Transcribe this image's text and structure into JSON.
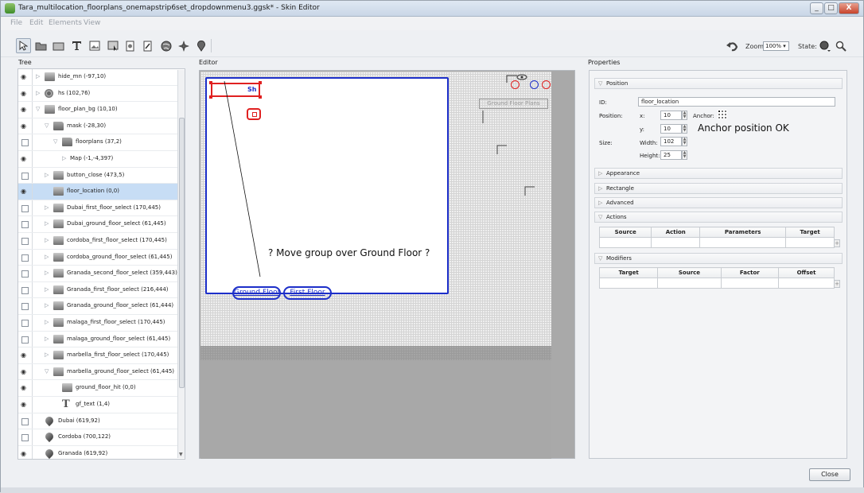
{
  "window": {
    "title": "Tara_multilocation_floorplans_onemapstrip6set_dropdownmenu3.ggsk* - Skin Editor",
    "minimize": "_",
    "maximize": "□",
    "close": "X"
  },
  "menu": [
    "File",
    "Edit",
    "Elements",
    "View"
  ],
  "toolbar": {
    "tools": [
      "select-tool",
      "folder-tool",
      "rectangle-tool",
      "text-tool",
      "image-tool",
      "button-tool",
      "hotspot-tool",
      "code-tool",
      "globe-tool",
      "compass-tool",
      "marker-tool"
    ],
    "zoom_label": "Zoom:",
    "zoom_value": "100%",
    "state_label": "State:"
  },
  "panels": {
    "tree": "Tree",
    "editor": "Editor",
    "properties": "Properties"
  },
  "tree": {
    "items": [
      {
        "label": "hide_mn (-97,10)",
        "visible": true,
        "expander": "closed",
        "icon": "rect",
        "indent": 0
      },
      {
        "label": "hs (102,76)",
        "visible": true,
        "expander": "closed",
        "icon": "hs",
        "indent": 0
      },
      {
        "label": "floor_plan_bg (10,10)",
        "visible": true,
        "expander": "open",
        "icon": "rect",
        "indent": 0
      },
      {
        "label": "mask (-28,30)",
        "visible": true,
        "expander": "open",
        "icon": "folder",
        "indent": 1
      },
      {
        "label": "floorplans (37,2)",
        "visible": false,
        "expander": "open",
        "icon": "folder",
        "indent": 2
      },
      {
        "label": "Map (-1,-4,397)",
        "visible": true,
        "expander": "closed",
        "icon": "none",
        "indent": 3
      },
      {
        "label": "button_close (473,5)",
        "visible": false,
        "expander": "closed",
        "icon": "rect",
        "indent": 1
      },
      {
        "label": "floor_location (0,0)",
        "visible": true,
        "expander": "none",
        "icon": "rect",
        "indent": 1,
        "selected": true
      },
      {
        "label": "Dubai_first_floor_select (170,445)",
        "visible": false,
        "expander": "closed",
        "icon": "rect",
        "indent": 1
      },
      {
        "label": "Dubai_ground_floor_select (61,445)",
        "visible": false,
        "expander": "closed",
        "icon": "rect",
        "indent": 1
      },
      {
        "label": "cordoba_first_floor_select (170,445)",
        "visible": false,
        "expander": "closed",
        "icon": "rect",
        "indent": 1
      },
      {
        "label": "cordoba_ground_floor_select (61,445)",
        "visible": false,
        "expander": "closed",
        "icon": "rect",
        "indent": 1
      },
      {
        "label": "Granada_second_floor_select (359,443)",
        "visible": false,
        "expander": "closed",
        "icon": "rect",
        "indent": 1
      },
      {
        "label": "Granada_first_floor_select (216,444)",
        "visible": false,
        "expander": "closed",
        "icon": "rect",
        "indent": 1
      },
      {
        "label": "Granada_ground_floor_select (61,444)",
        "visible": false,
        "expander": "closed",
        "icon": "rect",
        "indent": 1
      },
      {
        "label": "malaga_first_floor_select (170,445)",
        "visible": false,
        "expander": "closed",
        "icon": "rect",
        "indent": 1
      },
      {
        "label": "malaga_ground_floor_select (61,445)",
        "visible": false,
        "expander": "closed",
        "icon": "rect",
        "indent": 1
      },
      {
        "label": "marbella_first_floor_select (170,445)",
        "visible": true,
        "expander": "closed",
        "icon": "rect",
        "indent": 1
      },
      {
        "label": "marbella_ground_floor_select (61,445)",
        "visible": true,
        "expander": "open",
        "icon": "rect",
        "indent": 1
      },
      {
        "label": "ground_floor_hit (0,0)",
        "visible": true,
        "expander": "none",
        "icon": "rect",
        "indent": 2
      },
      {
        "label": "gf_text (1,4)",
        "visible": true,
        "expander": "none",
        "icon": "text",
        "indent": 2
      },
      {
        "label": "Dubai (619,92)",
        "visible": false,
        "expander": "none",
        "icon": "marker",
        "indent": 0
      },
      {
        "label": "Cordoba (700,122)",
        "visible": false,
        "expander": "none",
        "icon": "marker",
        "indent": 0
      },
      {
        "label": "Granada (619,92)",
        "visible": true,
        "expander": "none",
        "icon": "marker",
        "indent": 0
      }
    ]
  },
  "editor": {
    "sh_label": "Sh",
    "ground_floor": "Ground Floor",
    "first_floor": "First Floor",
    "note": "?  Move group over Ground Floor ?",
    "ghost_label": "Ground Floor Plans"
  },
  "properties": {
    "sections": {
      "position": "Position",
      "appearance": "Appearance",
      "rectangle": "Rectangle",
      "advanced": "Advanced",
      "actions": "Actions",
      "modifiers": "Modifiers"
    },
    "id_label": "ID:",
    "id_value": "floor_location",
    "position_label": "Position:",
    "x_label": "x:",
    "x_value": "10",
    "y_label": "y:",
    "y_value": "10",
    "anchor_label": "Anchor:",
    "anchor_note": "Anchor position OK",
    "size_label": "Size:",
    "width_label": "Width:",
    "width_value": "102",
    "height_label": "Height:",
    "height_value": "25",
    "actions_columns": [
      "Source",
      "Action",
      "Parameters",
      "Target"
    ],
    "modifiers_columns": [
      "Target",
      "Source",
      "Factor",
      "Offset"
    ]
  },
  "footer": {
    "close_button": "Close"
  },
  "colors": {
    "selection_red": "#e02020",
    "stage_blue": "#1d2fc9",
    "tree_selected": "#c7ddf5"
  }
}
